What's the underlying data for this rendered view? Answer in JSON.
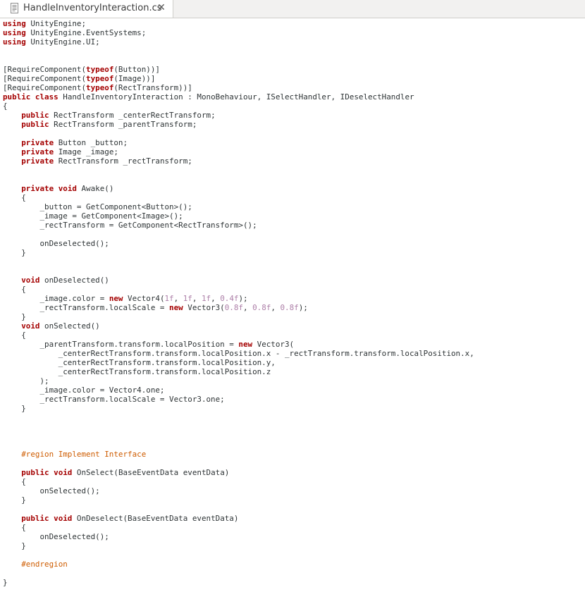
{
  "tab": {
    "title": "HandleInventoryInteraction.cs",
    "close_icon": "close-icon",
    "file_icon": "text-file-icon"
  },
  "colors": {
    "keyword": "#a40000",
    "number": "#ad7fa8",
    "preprocessor": "#ce5c00",
    "text": "#2e3436"
  },
  "code": {
    "lines": [
      [
        [
          "k",
          "using"
        ],
        [
          "t",
          " UnityEngine;"
        ]
      ],
      [
        [
          "k",
          "using"
        ],
        [
          "t",
          " UnityEngine.EventSystems;"
        ]
      ],
      [
        [
          "k",
          "using"
        ],
        [
          "t",
          " UnityEngine.UI;"
        ]
      ],
      [],
      [],
      [
        [
          "t",
          "[RequireComponent("
        ],
        [
          "k",
          "typeof"
        ],
        [
          "t",
          "(Button))]"
        ]
      ],
      [
        [
          "t",
          "[RequireComponent("
        ],
        [
          "k",
          "typeof"
        ],
        [
          "t",
          "(Image))]"
        ]
      ],
      [
        [
          "t",
          "[RequireComponent("
        ],
        [
          "k",
          "typeof"
        ],
        [
          "t",
          "(RectTransform))]"
        ]
      ],
      [
        [
          "k",
          "public"
        ],
        [
          "t",
          " "
        ],
        [
          "k",
          "class"
        ],
        [
          "t",
          " HandleInventoryInteraction : MonoBehaviour, ISelectHandler, IDeselectHandler"
        ]
      ],
      [
        [
          "t",
          "{"
        ]
      ],
      [
        [
          "t",
          "    "
        ],
        [
          "k",
          "public"
        ],
        [
          "t",
          " RectTransform _centerRectTransform;"
        ]
      ],
      [
        [
          "t",
          "    "
        ],
        [
          "k",
          "public"
        ],
        [
          "t",
          " RectTransform _parentTransform;"
        ]
      ],
      [],
      [
        [
          "t",
          "    "
        ],
        [
          "k",
          "private"
        ],
        [
          "t",
          " Button _button;"
        ]
      ],
      [
        [
          "t",
          "    "
        ],
        [
          "k",
          "private"
        ],
        [
          "t",
          " Image _image;"
        ]
      ],
      [
        [
          "t",
          "    "
        ],
        [
          "k",
          "private"
        ],
        [
          "t",
          " RectTransform _rectTransform;"
        ]
      ],
      [],
      [],
      [
        [
          "t",
          "    "
        ],
        [
          "k",
          "private"
        ],
        [
          "t",
          " "
        ],
        [
          "k",
          "void"
        ],
        [
          "t",
          " Awake()"
        ]
      ],
      [
        [
          "t",
          "    {"
        ]
      ],
      [
        [
          "t",
          "        _button = GetComponent<Button>();"
        ]
      ],
      [
        [
          "t",
          "        _image = GetComponent<Image>();"
        ]
      ],
      [
        [
          "t",
          "        _rectTransform = GetComponent<RectTransform>();"
        ]
      ],
      [],
      [
        [
          "t",
          "        onDeselected();"
        ]
      ],
      [
        [
          "t",
          "    }"
        ]
      ],
      [],
      [],
      [
        [
          "t",
          "    "
        ],
        [
          "k",
          "void"
        ],
        [
          "t",
          " onDeselected()"
        ]
      ],
      [
        [
          "t",
          "    {"
        ]
      ],
      [
        [
          "t",
          "        _image.color = "
        ],
        [
          "k",
          "new"
        ],
        [
          "t",
          " Vector4("
        ],
        [
          "n",
          "1f"
        ],
        [
          "t",
          ", "
        ],
        [
          "n",
          "1f"
        ],
        [
          "t",
          ", "
        ],
        [
          "n",
          "1f"
        ],
        [
          "t",
          ", "
        ],
        [
          "n",
          "0.4f"
        ],
        [
          "t",
          ");"
        ]
      ],
      [
        [
          "t",
          "        _rectTransform.localScale = "
        ],
        [
          "k",
          "new"
        ],
        [
          "t",
          " Vector3("
        ],
        [
          "n",
          "0.8f"
        ],
        [
          "t",
          ", "
        ],
        [
          "n",
          "0.8f"
        ],
        [
          "t",
          ", "
        ],
        [
          "n",
          "0.8f"
        ],
        [
          "t",
          ");"
        ]
      ],
      [
        [
          "t",
          "    }"
        ]
      ],
      [
        [
          "t",
          "    "
        ],
        [
          "k",
          "void"
        ],
        [
          "t",
          " onSelected()"
        ]
      ],
      [
        [
          "t",
          "    {"
        ]
      ],
      [
        [
          "t",
          "        _parentTransform.transform.localPosition = "
        ],
        [
          "k",
          "new"
        ],
        [
          "t",
          " Vector3("
        ]
      ],
      [
        [
          "t",
          "            _centerRectTransform.transform.localPosition.x - _rectTransform.transform.localPosition.x,"
        ]
      ],
      [
        [
          "t",
          "            _centerRectTransform.transform.localPosition.y,"
        ]
      ],
      [
        [
          "t",
          "            _centerRectTransform.transform.localPosition.z"
        ]
      ],
      [
        [
          "t",
          "        );"
        ]
      ],
      [
        [
          "t",
          "        _image.color = Vector4.one;"
        ]
      ],
      [
        [
          "t",
          "        _rectTransform.localScale = Vector3.one;"
        ]
      ],
      [
        [
          "t",
          "    }"
        ]
      ],
      [],
      [],
      [],
      [],
      [
        [
          "t",
          "    "
        ],
        [
          "p",
          "#region Implement Interface"
        ]
      ],
      [],
      [
        [
          "t",
          "    "
        ],
        [
          "k",
          "public"
        ],
        [
          "t",
          " "
        ],
        [
          "k",
          "void"
        ],
        [
          "t",
          " OnSelect(BaseEventData eventData)"
        ]
      ],
      [
        [
          "t",
          "    {"
        ]
      ],
      [
        [
          "t",
          "        onSelected();"
        ]
      ],
      [
        [
          "t",
          "    }"
        ]
      ],
      [],
      [
        [
          "t",
          "    "
        ],
        [
          "k",
          "public"
        ],
        [
          "t",
          " "
        ],
        [
          "k",
          "void"
        ],
        [
          "t",
          " OnDeselect(BaseEventData eventData)"
        ]
      ],
      [
        [
          "t",
          "    {"
        ]
      ],
      [
        [
          "t",
          "        onDeselected();"
        ]
      ],
      [
        [
          "t",
          "    }"
        ]
      ],
      [],
      [
        [
          "t",
          "    "
        ],
        [
          "p",
          "#endregion"
        ]
      ],
      [],
      [
        [
          "t",
          "}"
        ]
      ]
    ]
  }
}
